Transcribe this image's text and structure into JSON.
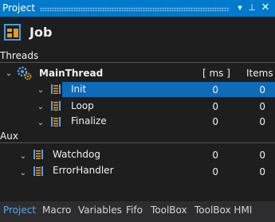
{
  "panel": {
    "title": "Project"
  },
  "header": {
    "title": "Job"
  },
  "sections": {
    "threads": "Threads",
    "aux": "Aux"
  },
  "columns": {
    "ms": "[ ms ]",
    "items": "Items"
  },
  "main_thread": {
    "label": "MainThread"
  },
  "rows": [
    {
      "label": "Init",
      "ms": "0",
      "items": "0",
      "selected": true
    },
    {
      "label": "Loop",
      "ms": "0",
      "items": "0"
    },
    {
      "label": "Finalize",
      "ms": "0",
      "items": "0"
    }
  ],
  "aux_rows": [
    {
      "label": "Watchdog",
      "ms": "0",
      "items": "0"
    },
    {
      "label": "ErrorHandler",
      "ms": "0",
      "items": "0"
    }
  ],
  "tabs": [
    "Project",
    "Macro",
    "Variables",
    "Fifo",
    "ToolBox",
    "ToolBox HMI"
  ],
  "active_tab": "Project",
  "icons": {
    "dropdown": "chevron-down-icon",
    "pin": "pin-icon",
    "close": "close-icon",
    "job": "job-icon",
    "gear": "gear-icon",
    "thread": "thread-icon"
  },
  "colors": {
    "accent": "#007acc",
    "selection": "#0e6bb8",
    "background": "#1e1e1e",
    "tab_active": "#5aa8ea"
  }
}
